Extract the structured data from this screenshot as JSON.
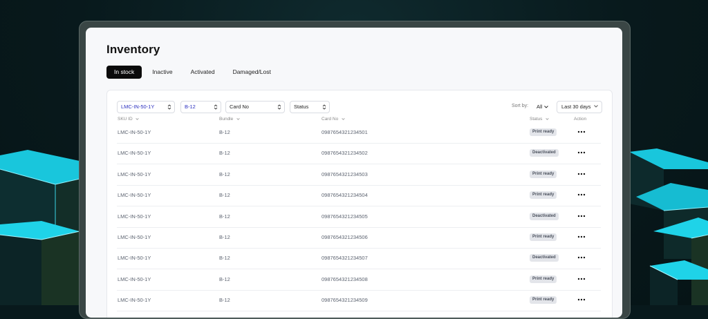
{
  "page": {
    "title": "Inventory"
  },
  "tabs": [
    {
      "label": "In stock",
      "active": true
    },
    {
      "label": "Inactive",
      "active": false
    },
    {
      "label": "Activated",
      "active": false
    },
    {
      "label": "Damaged/Lost",
      "active": false
    }
  ],
  "filters": {
    "sku": "LMC-IN-50-1Y",
    "bundle": "B-12",
    "card_no": "Card No",
    "status": "Status"
  },
  "sort": {
    "label": "Sort by:",
    "value": "All",
    "date_range": "Last 30 days"
  },
  "columns": {
    "sku": "SKU ID",
    "bundle": "Bundle",
    "card": "Card No",
    "status": "Status",
    "action": "Action"
  },
  "rows": [
    {
      "sku": "LMC-IN-50-1Y",
      "bundle": "B-12",
      "card": "0987654321234501",
      "status": "Print ready"
    },
    {
      "sku": "LMC-IN-50-1Y",
      "bundle": "B-12",
      "card": "0987654321234502",
      "status": "Deactivated"
    },
    {
      "sku": "LMC-IN-50-1Y",
      "bundle": "B-12",
      "card": "0987654321234503",
      "status": "Print ready"
    },
    {
      "sku": "LMC-IN-50-1Y",
      "bundle": "B-12",
      "card": "0987654321234504",
      "status": "Print ready"
    },
    {
      "sku": "LMC-IN-50-1Y",
      "bundle": "B-12",
      "card": "0987654321234505",
      "status": "Deactivated"
    },
    {
      "sku": "LMC-IN-50-1Y",
      "bundle": "B-12",
      "card": "0987654321234506",
      "status": "Print ready"
    },
    {
      "sku": "LMC-IN-50-1Y",
      "bundle": "B-12",
      "card": "0987654321234507",
      "status": "Deactivated"
    },
    {
      "sku": "LMC-IN-50-1Y",
      "bundle": "B-12",
      "card": "0987654321234508",
      "status": "Print ready"
    },
    {
      "sku": "LMC-IN-50-1Y",
      "bundle": "B-12",
      "card": "0987654321234509",
      "status": "Print ready"
    }
  ],
  "colors": {
    "accent": "#2a2fbf",
    "background": "#08191c",
    "cube": "#19c6dc",
    "active_tab": "#0b0b0b"
  },
  "icons": {
    "sort": "chevron-updown-icon",
    "dropdown": "chevron-down-icon",
    "action": "more-horizontal-icon"
  }
}
